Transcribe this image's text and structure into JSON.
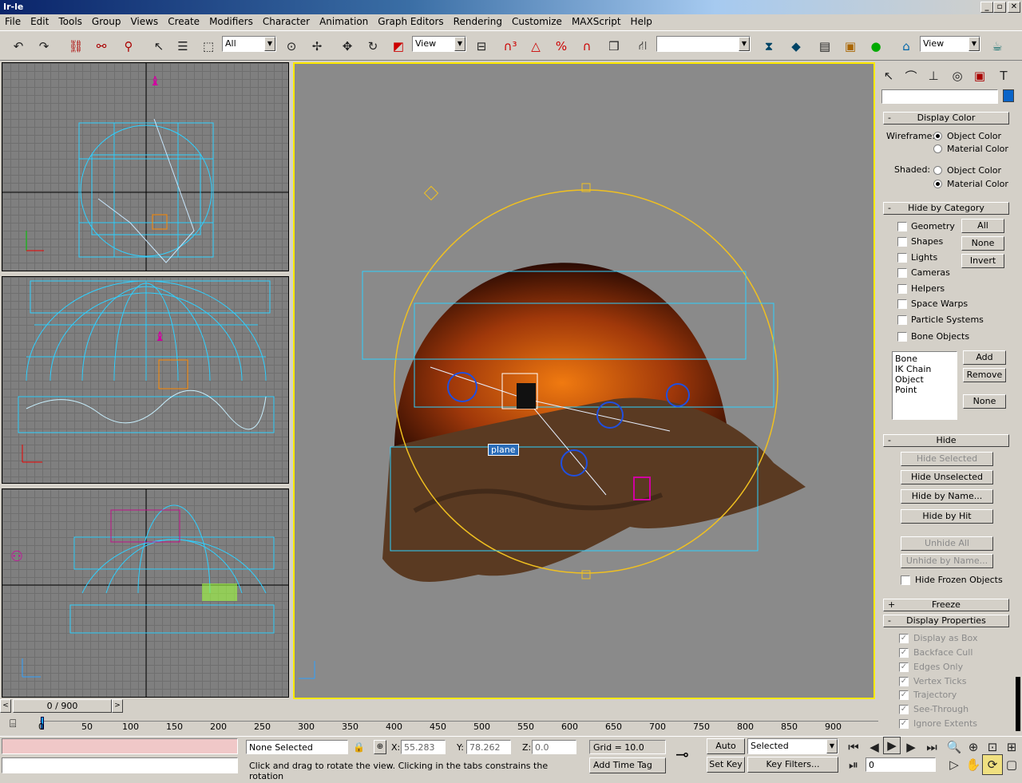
{
  "app": {
    "title": "Ir-le",
    "win_buttons": [
      "_",
      "▫",
      "✕"
    ]
  },
  "menu": [
    "File",
    "Edit",
    "Tools",
    "Group",
    "Views",
    "Create",
    "Modifiers",
    "Character",
    "Animation",
    "Graph Editors",
    "Rendering",
    "Customize",
    "MAXScript",
    "Help"
  ],
  "toolbar": {
    "selection_filter": "All",
    "ref_coord": "View",
    "named_sel": "",
    "view_combo": "View"
  },
  "viewport": {
    "object_label": "plane"
  },
  "panel": {
    "display_color": {
      "title": "Display Color",
      "wireframe_label": "Wireframe:",
      "shaded_label": "Shaded:",
      "object_color": "Object Color",
      "material_color": "Material Color"
    },
    "hide_by_category": {
      "title": "Hide by Category",
      "items": [
        "Geometry",
        "Shapes",
        "Lights",
        "Cameras",
        "Helpers",
        "Space Warps",
        "Particle Systems",
        "Bone Objects"
      ],
      "buttons": [
        "All",
        "None",
        "Invert"
      ],
      "list": [
        "Bone",
        "IK Chain Object",
        "Point"
      ],
      "list_buttons": [
        "Add",
        "Remove",
        "None"
      ]
    },
    "hide": {
      "title": "Hide",
      "buttons": [
        "Hide Selected",
        "Hide Unselected",
        "Hide by Name...",
        "Hide by Hit",
        "Unhide All",
        "Unhide by Name..."
      ],
      "frozen": "Hide Frozen Objects"
    },
    "freeze": {
      "title": "Freeze"
    },
    "display_props": {
      "title": "Display Properties",
      "items": [
        "Display as Box",
        "Backface Cull",
        "Edges Only",
        "Vertex Ticks",
        "Trajectory",
        "See-Through",
        "Ignore Extents"
      ]
    }
  },
  "timeline": {
    "slider": "0 / 900",
    "ticks": [
      "0",
      "50",
      "100",
      "150",
      "200",
      "250",
      "300",
      "350",
      "400",
      "450",
      "500",
      "550",
      "600",
      "650",
      "700",
      "750",
      "800",
      "850",
      "900"
    ]
  },
  "status": {
    "selection": "None Selected",
    "x_label": "X:",
    "x": "55.283",
    "y_label": "Y:",
    "y": "78.262",
    "z_label": "Z:",
    "z": "0.0",
    "grid": "Grid = 10.0",
    "prompt": "Click and drag to rotate the view.  Clicking in the tabs constrains the rotation",
    "add_time_tag": "Add Time Tag",
    "auto_key": "Auto Key",
    "selected": "Selected",
    "set_key": "Set Key",
    "key_filters": "Key Filters...",
    "frame": "0"
  }
}
